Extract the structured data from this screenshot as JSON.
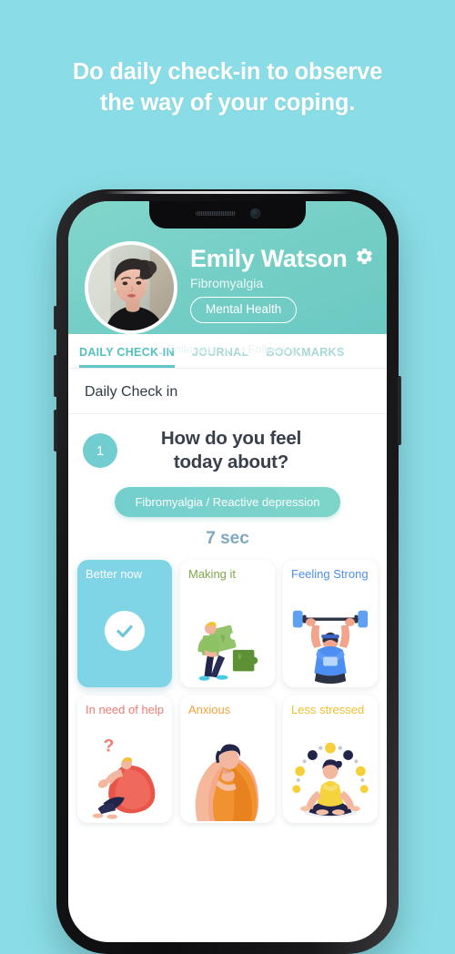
{
  "promo": {
    "headline_line1": "Do daily check-in to observe",
    "headline_line2": "the way of your coping.",
    "background_color": "#8adde6"
  },
  "app": {
    "header": {
      "user_name": "Emily Watson",
      "condition": "Fibromyalgia",
      "tag": "Mental Health",
      "followers_count": "0",
      "followers_label": "Followers",
      "separator": "•",
      "following_count": "5",
      "following_label": "Following",
      "settings_icon": "gear-icon",
      "accent_color": "#74cec6"
    },
    "tabs": [
      {
        "label": "DAILY CHECK-IN",
        "active": true
      },
      {
        "label": "JOURNAL",
        "active": false
      },
      {
        "label": "BOOKMARKS",
        "active": false
      }
    ],
    "section_title": "Daily Check in",
    "question": {
      "number": "1",
      "text_line1": "How do you feel",
      "text_line2": "today about?",
      "topic_pill": "Fibromyalgia / Reactive depression",
      "timer": "7 sec",
      "timer_color": "#7fa9be"
    },
    "options": [
      {
        "label": "Better now",
        "label_color": "#ffffff",
        "selected": true,
        "icon": "check-circle-icon"
      },
      {
        "label": "Making it",
        "label_color": "#7fa84a",
        "selected": false,
        "icon": "puzzle-person-illustration"
      },
      {
        "label": "Feeling Strong",
        "label_color": "#4e8ff0",
        "selected": false,
        "icon": "weightlifter-illustration"
      },
      {
        "label": "In need of help",
        "label_color": "#ef7b73",
        "selected": false,
        "icon": "person-question-illustration"
      },
      {
        "label": "Anxious",
        "label_color": "#f0a33c",
        "selected": false,
        "icon": "person-thinking-illustration"
      },
      {
        "label": "Less stressed",
        "label_color": "#f0c030",
        "selected": false,
        "icon": "meditation-illustration"
      }
    ]
  }
}
